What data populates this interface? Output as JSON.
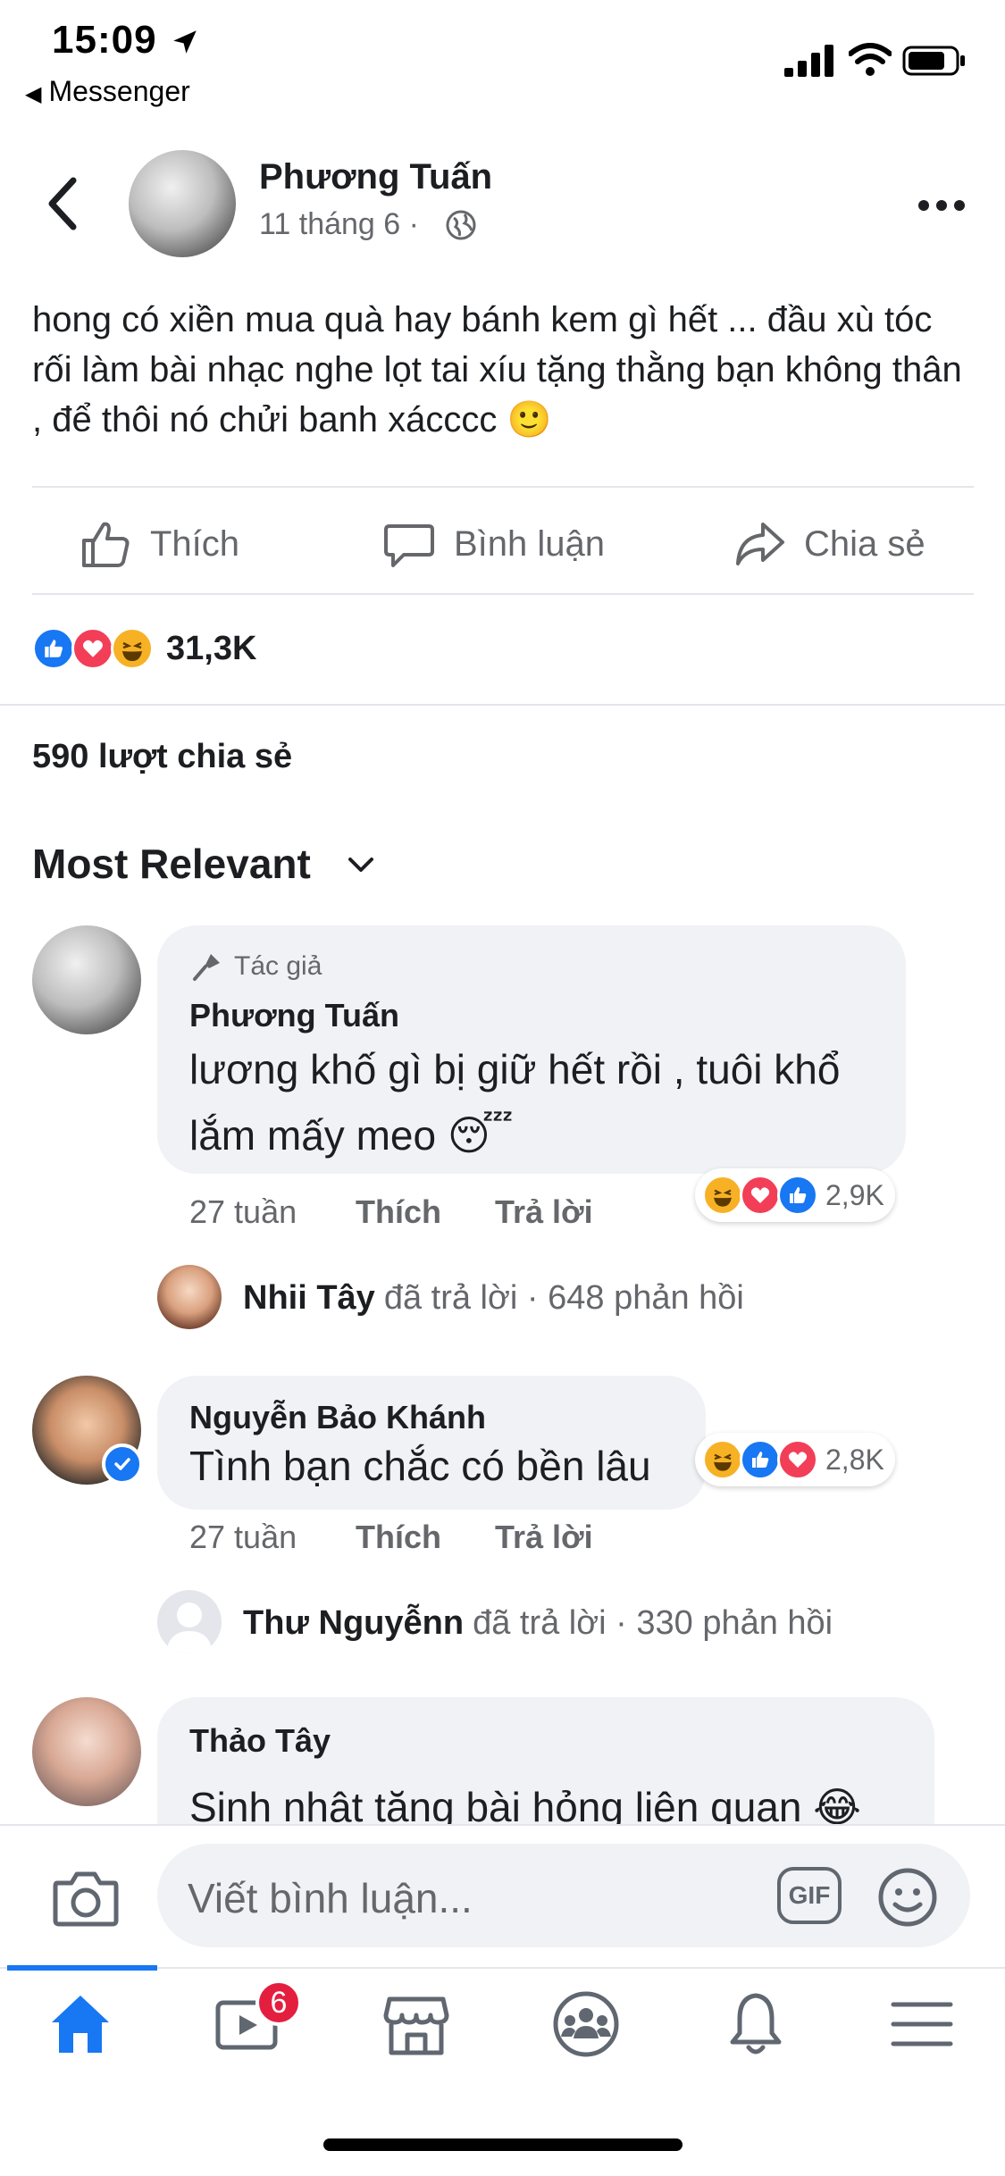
{
  "status_bar": {
    "time": "15:09",
    "back_app": "Messenger"
  },
  "post": {
    "author": "Phương Tuấn",
    "date": "11 tháng 6",
    "date_sep": "·",
    "text": "hong có xiền mua quà hay bánh kem gì hết ... đầu xù tóc rối làm bài nhạc nghe lọt tai xíu tặng thằng bạn không thân , để thôi nó chửi banh xácccc 🙂",
    "actions": {
      "like": "Thích",
      "comment": "Bình luận",
      "share": "Chia sẻ"
    },
    "reaction_count": "31,3K",
    "share_count": "590 lượt chia sẻ"
  },
  "comments_header": {
    "sort_label": "Most Relevant"
  },
  "comments": [
    {
      "tag": "Tác giả",
      "author": "Phương Tuấn",
      "text_line1": "lương khố gì bị giữ hết rồi , tuôi khổ",
      "text_line2": "lắm mấy meo 😴",
      "time": "27 tuần",
      "like": "Thích",
      "reply": "Trả lời",
      "reaction_count": "2,9K",
      "reply_summary": {
        "name": "Nhii Tây",
        "text": "đã trả lời · 648 phản hồi"
      }
    },
    {
      "author": "Nguyễn Bảo Khánh",
      "text": "Tình bạn chắc có bền lâu",
      "time": "27 tuần",
      "like": "Thích",
      "reply": "Trả lời",
      "reaction_count": "2,8K",
      "reply_summary": {
        "name": "Thư Nguyễnn",
        "text": "đã trả lời · 330 phản hồi"
      }
    },
    {
      "author": "Thảo Tây",
      "text": "Sinh nhật tặng bài hỏng liên quan 😂"
    }
  ],
  "composer": {
    "placeholder": "Viết bình luận...",
    "gif_label": "GIF"
  },
  "tabbar": {
    "video_badge": "6",
    "items": [
      "home-icon",
      "video-icon",
      "marketplace-icon",
      "groups-icon",
      "bell-icon",
      "menu-icon"
    ]
  },
  "colors": {
    "accent": "#1877f2",
    "love": "#f33e58",
    "haha": "#f7b125",
    "badge": "#e41e3f",
    "bubble": "#f0f2f5",
    "secondary_text": "#65676b"
  }
}
